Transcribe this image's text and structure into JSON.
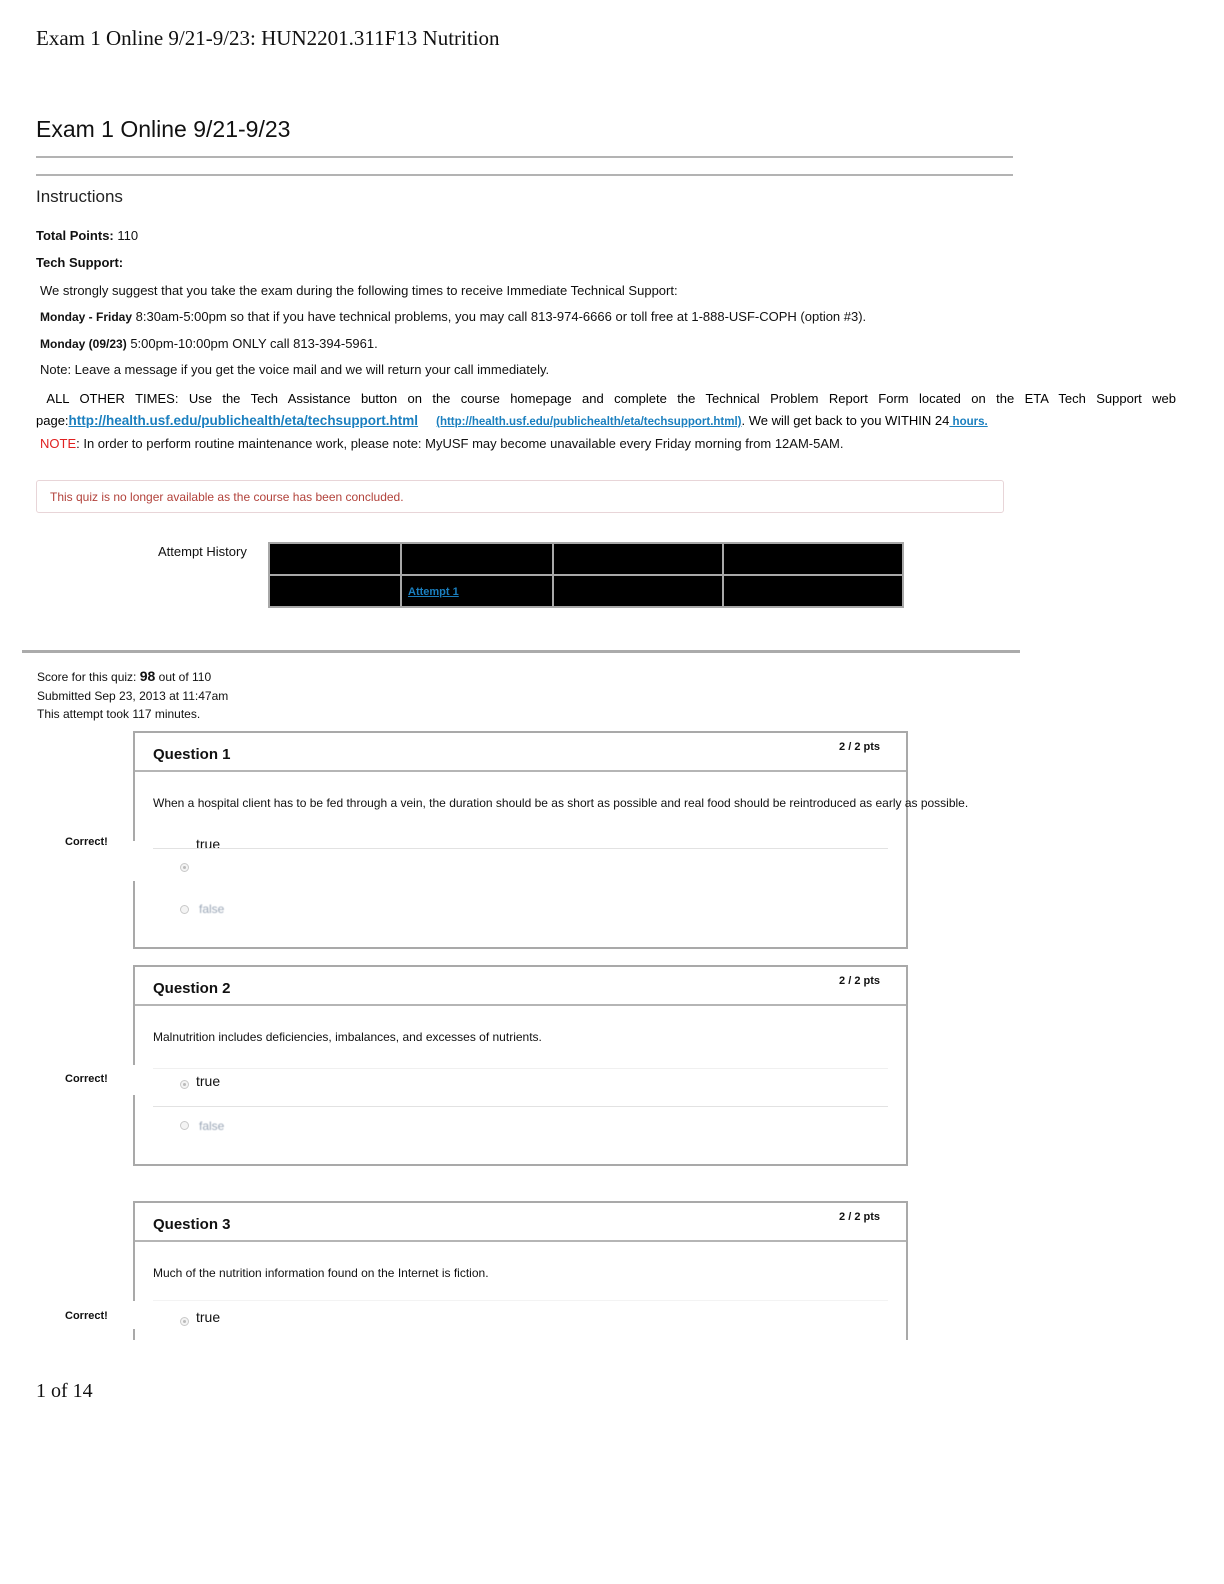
{
  "print_header": "Exam 1 Online 9/21-9/23: HUN2201.311F13 Nutrition",
  "page_title": "Exam 1 Online 9/21-9/23",
  "instructions": {
    "heading": "Instructions",
    "total_points_label": "Total Points:",
    "total_points_value": "110",
    "tech_support_label": "Tech Support:",
    "suggest_text": "We strongly suggest that you take the exam during the following times to receive Immediate Technical Support:",
    "weekday_label": "Monday - Friday",
    "weekday_text": "8:30am-5:00pm so that if you have technical problems, you may call 813-974-6666 or toll free at 1-888-USF-COPH (option #3).",
    "monday_label": "Monday (09/23)",
    "monday_text": "5:00pm-10:00pm ONLY call 813-394-5961.",
    "note_text": "Note: Leave a message if you get the voice mail and we will return your call immediately.",
    "other_times_text": "ALL OTHER TIMES: Use the Tech Assistance button on the course homepage and complete the Technical Problem Report Form located on the ETA Tech Support web page:",
    "support_link": "http://health.usf.edu/publichealth/eta/techsupport.html",
    "support_link_paren": "(http://health.usf.edu/publichealth/eta/techsupport.html)",
    "within_text": ". We will get back to you WITHIN 24",
    "hours_link": " hours.",
    "maint_label": "NOTE",
    "maint_text": ": In order to perform routine maintenance work, please note: MyUSF may become unavailable every Friday morning from 12AM-5AM."
  },
  "alert": {
    "message": "This quiz is no longer available as the course has been concluded."
  },
  "attempt_history": {
    "label": "Attempt History",
    "rows": [
      [
        "",
        "",
        "",
        ""
      ],
      [
        "",
        "Attempt 1",
        "",
        ""
      ]
    ]
  },
  "score": {
    "prefix": "Score for this quiz:",
    "value": "98",
    "suffix": "out of 110",
    "submitted": "Submitted Sep 23, 2013 at 11:47am",
    "duration": "This attempt took 117 minutes."
  },
  "questions": [
    {
      "title": "Question 1",
      "points": "2 / 2 pts",
      "text": "When a hospital client has to be fed through a vein, the duration should be as short as possible and real food should be reintroduced as early as possible.",
      "result": "Correct!",
      "answers": [
        {
          "label": "true",
          "selected": true
        },
        {
          "label": "false",
          "selected": false
        }
      ]
    },
    {
      "title": "Question 2",
      "points": "2 / 2 pts",
      "text": "Malnutrition includes deficiencies, imbalances, and excesses of nutrients.",
      "result": "Correct!",
      "answers": [
        {
          "label": "true",
          "selected": true
        },
        {
          "label": "false",
          "selected": false
        }
      ]
    },
    {
      "title": "Question 3",
      "points": "2 / 2 pts",
      "text": "Much of the nutrition information found on the Internet is fiction.",
      "result": "Correct!",
      "answers": [
        {
          "label": "true",
          "selected": true
        }
      ]
    }
  ],
  "page_footer": "1 of 14"
}
